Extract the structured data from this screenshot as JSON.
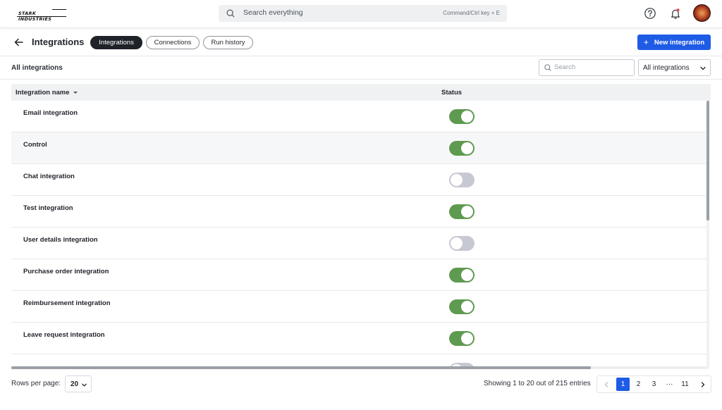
{
  "brand": {
    "logo_text": "STARK INDUSTRIES"
  },
  "topbar": {
    "search_placeholder": "Search everything",
    "shortcut": "Command/Ctrl key + E",
    "icons": [
      "search-icon",
      "help-icon",
      "bell-icon",
      "avatar"
    ]
  },
  "header": {
    "title": "Integrations",
    "tabs": [
      {
        "label": "Integrations",
        "active": true
      },
      {
        "label": "Connections",
        "active": false
      },
      {
        "label": "Run history",
        "active": false
      }
    ],
    "new_button": "New integration"
  },
  "filter": {
    "title": "All integrations",
    "search_placeholder": "Search",
    "select_value": "All integrations"
  },
  "table": {
    "columns": {
      "name": "Integration name",
      "status": "Status"
    },
    "rows": [
      {
        "name": "Email integration",
        "enabled": true
      },
      {
        "name": "Control",
        "enabled": true
      },
      {
        "name": "Chat integration",
        "enabled": false
      },
      {
        "name": "Test integration",
        "enabled": true
      },
      {
        "name": "User details integration",
        "enabled": false
      },
      {
        "name": "Purchase order integration",
        "enabled": true
      },
      {
        "name": "Reimbursement integration",
        "enabled": true
      },
      {
        "name": "Leave request integration",
        "enabled": true
      },
      {
        "name": "",
        "enabled": false
      }
    ]
  },
  "footer": {
    "rows_per_page_label": "Rows per page:",
    "rows_per_page_value": "20",
    "showing": "Showing 1 to 20 out of 215 entries",
    "pages": [
      "1",
      "2",
      "3",
      "···",
      "11"
    ],
    "current_page": "1"
  },
  "colors": {
    "accent": "#1f5ce6",
    "toggle_on": "#5e9a4f",
    "toggle_off": "#c6c9d1"
  }
}
